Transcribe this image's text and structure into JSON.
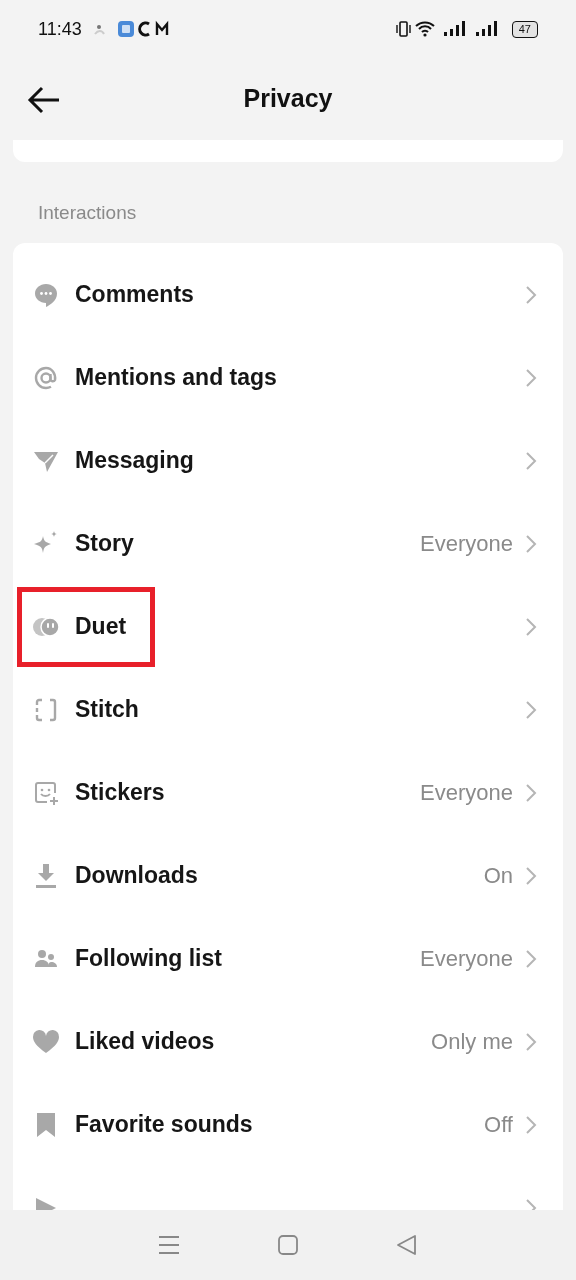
{
  "status_bar": {
    "time": "11:43",
    "battery": "47"
  },
  "header": {
    "title": "Privacy"
  },
  "section": {
    "title": "Interactions"
  },
  "items": [
    {
      "kind": "comment",
      "label": "Comments",
      "highlighted": false
    },
    {
      "kind": "at",
      "label": "Mentions and tags",
      "highlighted": false
    },
    {
      "kind": "send",
      "label": "Messaging",
      "highlighted": false
    },
    {
      "kind": "sparkle",
      "label": "Story",
      "value": "Everyone",
      "highlighted": false
    },
    {
      "kind": "duet",
      "label": "Duet",
      "highlighted": true
    },
    {
      "kind": "stitch",
      "label": "Stitch",
      "highlighted": false
    },
    {
      "kind": "sticker",
      "label": "Stickers",
      "value": "Everyone",
      "highlighted": false
    },
    {
      "kind": "download",
      "label": "Downloads",
      "value": "On",
      "highlighted": false
    },
    {
      "kind": "people",
      "label": "Following list",
      "value": "Everyone",
      "highlighted": false
    },
    {
      "kind": "heart",
      "label": "Liked videos",
      "value": "Only me",
      "highlighted": false
    },
    {
      "kind": "bookmark",
      "label": "Favorite sounds",
      "value": "Off",
      "highlighted": false
    },
    {
      "kind": "play",
      "highlighted": false
    }
  ]
}
